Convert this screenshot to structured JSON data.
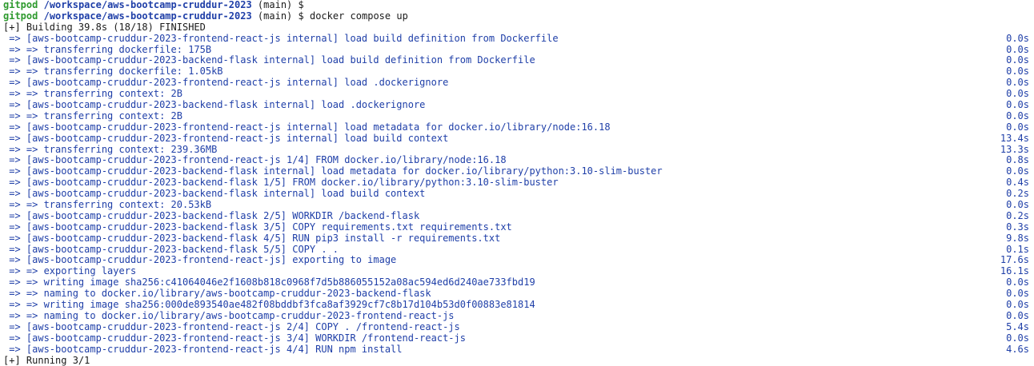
{
  "prompt": {
    "user": "gitpod",
    "path": "/workspace/aws-bootcamp-cruddur-2023",
    "branch": "(main)",
    "sign": "$"
  },
  "command": "docker compose up",
  "build_header": "[+] Building 39.8s (18/18) FINISHED",
  "steps": [
    {
      "text": " => [aws-bootcamp-cruddur-2023-frontend-react-js internal] load build definition from Dockerfile",
      "time": "0.0s"
    },
    {
      "text": " => => transferring dockerfile: 175B",
      "time": "0.0s"
    },
    {
      "text": " => [aws-bootcamp-cruddur-2023-backend-flask internal] load build definition from Dockerfile",
      "time": "0.0s"
    },
    {
      "text": " => => transferring dockerfile: 1.05kB",
      "time": "0.0s"
    },
    {
      "text": " => [aws-bootcamp-cruddur-2023-frontend-react-js internal] load .dockerignore",
      "time": "0.0s"
    },
    {
      "text": " => => transferring context: 2B",
      "time": "0.0s"
    },
    {
      "text": " => [aws-bootcamp-cruddur-2023-backend-flask internal] load .dockerignore",
      "time": "0.0s"
    },
    {
      "text": " => => transferring context: 2B",
      "time": "0.0s"
    },
    {
      "text": " => [aws-bootcamp-cruddur-2023-frontend-react-js internal] load metadata for docker.io/library/node:16.18",
      "time": "0.0s"
    },
    {
      "text": " => [aws-bootcamp-cruddur-2023-frontend-react-js internal] load build context",
      "time": "13.4s"
    },
    {
      "text": " => => transferring context: 239.36MB",
      "time": "13.3s"
    },
    {
      "text": " => [aws-bootcamp-cruddur-2023-frontend-react-js 1/4] FROM docker.io/library/node:16.18",
      "time": "0.8s"
    },
    {
      "text": " => [aws-bootcamp-cruddur-2023-backend-flask internal] load metadata for docker.io/library/python:3.10-slim-buster",
      "time": "0.0s"
    },
    {
      "text": " => [aws-bootcamp-cruddur-2023-backend-flask 1/5] FROM docker.io/library/python:3.10-slim-buster",
      "time": "0.4s"
    },
    {
      "text": " => [aws-bootcamp-cruddur-2023-backend-flask internal] load build context",
      "time": "0.2s"
    },
    {
      "text": " => => transferring context: 20.53kB",
      "time": "0.0s"
    },
    {
      "text": " => [aws-bootcamp-cruddur-2023-backend-flask 2/5] WORKDIR /backend-flask",
      "time": "0.2s"
    },
    {
      "text": " => [aws-bootcamp-cruddur-2023-backend-flask 3/5] COPY requirements.txt requirements.txt",
      "time": "0.3s"
    },
    {
      "text": " => [aws-bootcamp-cruddur-2023-backend-flask 4/5] RUN pip3 install -r requirements.txt",
      "time": "9.8s"
    },
    {
      "text": " => [aws-bootcamp-cruddur-2023-backend-flask 5/5] COPY . .",
      "time": "0.1s"
    },
    {
      "text": " => [aws-bootcamp-cruddur-2023-frontend-react-js] exporting to image",
      "time": "17.6s"
    },
    {
      "text": " => => exporting layers",
      "time": "16.1s"
    },
    {
      "text": " => => writing image sha256:c41064046e2f1608b818c0968f7d5b886055152a08ac594ed6d240ae733fbd19",
      "time": "0.0s"
    },
    {
      "text": " => => naming to docker.io/library/aws-bootcamp-cruddur-2023-backend-flask",
      "time": "0.0s"
    },
    {
      "text": " => => writing image sha256:000de893540ae482f08bddbf3fca8af3929cf7c8b17d104b53d0f00883e81814",
      "time": "0.0s"
    },
    {
      "text": " => => naming to docker.io/library/aws-bootcamp-cruddur-2023-frontend-react-js",
      "time": "0.0s"
    },
    {
      "text": " => [aws-bootcamp-cruddur-2023-frontend-react-js 2/4] COPY . /frontend-react-js",
      "time": "5.4s"
    },
    {
      "text": " => [aws-bootcamp-cruddur-2023-frontend-react-js 3/4] WORKDIR /frontend-react-js",
      "time": "0.0s"
    },
    {
      "text": " => [aws-bootcamp-cruddur-2023-frontend-react-js 4/4] RUN npm install",
      "time": "4.6s"
    }
  ],
  "footer": "[+] Running 3/1"
}
